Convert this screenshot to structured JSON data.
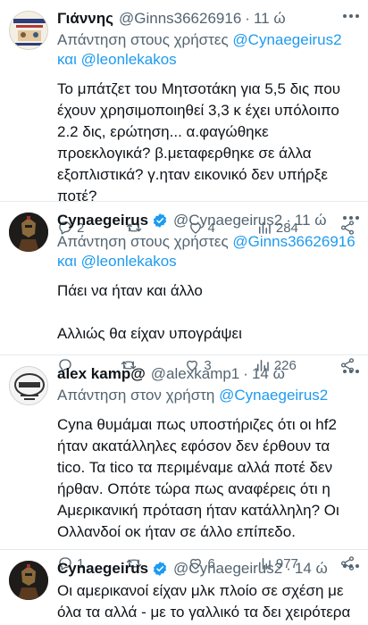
{
  "tweets": [
    {
      "name": "Γιάννης",
      "handle": "@Ginns36626916",
      "time": "11 ώ",
      "replying_prefix": "Απάντηση στους χρήστες",
      "mention1": "@Cynaegeirus2",
      "and_word": "και",
      "mention2": "@leonlekakos",
      "text": "Το μπάτζετ του Μητσοτάκη για 5,5 δις που έχουν χρησιμοποιηθεί 3,3 κ έχει υπόλοιπο 2.2 δις, ερώτηση... α.φαγώθηκε προεκλογικά? β.μεταφερθηκε σε άλλα εξοπλιστικά? γ.ηταν εικονικό δεν υπήρξε ποτέ?",
      "replies": "2",
      "retweets": "",
      "likes": "4",
      "views": "284",
      "avatar_text": "ΝΕΑ ΠΟΛΙΤΙΚΗ"
    },
    {
      "name": "Cynaegeirus",
      "handle": "@Cynaegeirus2",
      "time": "11 ώ",
      "replying_prefix": "Απάντηση στους χρήστες",
      "mention1": "@Ginns36626916",
      "and_word": "και",
      "mention2": "@leonlekakos",
      "text": "Πάει να ήταν και άλλο\n\nΑλλιώς θα είχαν υπογράψει",
      "replies": "",
      "retweets": "",
      "likes": "3",
      "views": "226"
    },
    {
      "name": "alex kamp@",
      "handle": "@alexkamp1",
      "time": "14 ώ",
      "replying_prefix": "Απάντηση στον χρήστη",
      "mention1": "@Cynaegeirus2",
      "text": "Cyna θυμάμαι πως υποστήριζες ότι οι hf2 ήταν ακατάλληλες εφόσον δεν έρθουν τα tico. Τα tico τα περιμέναμε αλλά ποτέ δεν ήρθαν. Οπότε τώρα πως αναφέρεις ότι η Αμερικανική πρόταση ήταν κατάλληλη? Οι Ολλανδοί οκ ήταν σε άλλο επίπεδο.",
      "replies": "1",
      "retweets": "",
      "likes": "6",
      "views": "977"
    },
    {
      "name": "Cynaegeirus",
      "handle": "@Cynaegeirus2",
      "time": "14 ώ",
      "text": "Οι αμερικανοί είχαν μλκ πλοίο σε σχέση με όλα τα αλλά - με το γαλλικό τα δει χειρότερα"
    }
  ],
  "colors": {
    "accent": "#1d9bf0",
    "muted": "#536471"
  }
}
